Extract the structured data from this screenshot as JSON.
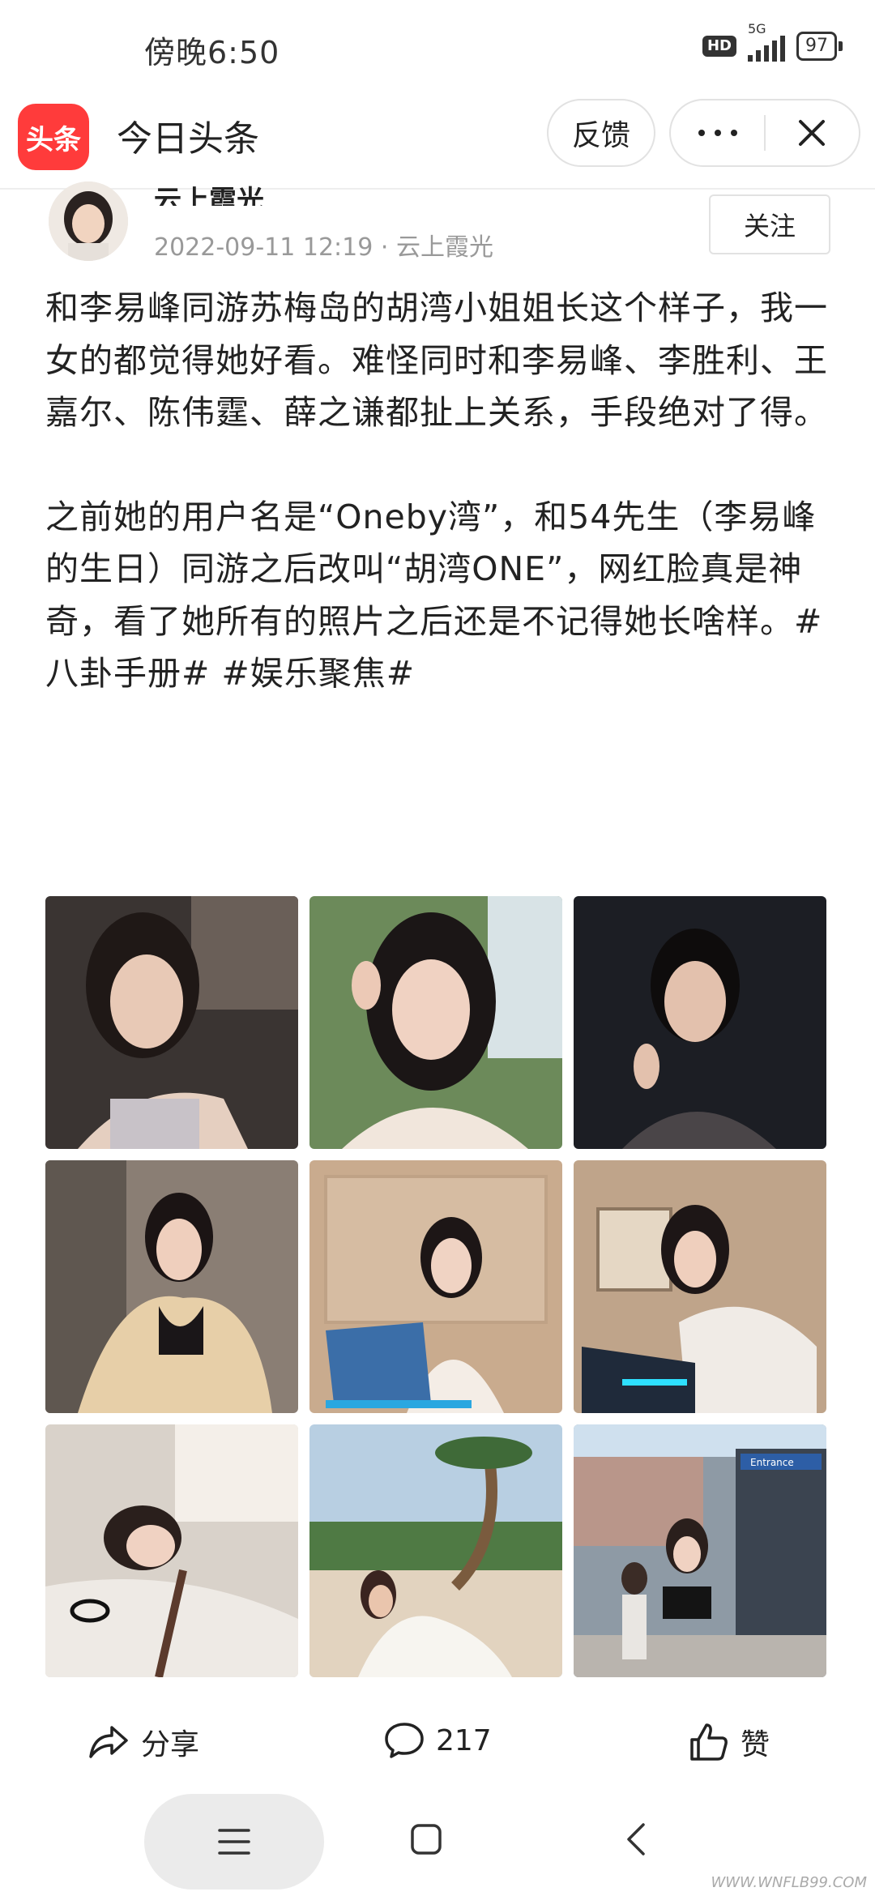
{
  "status_bar": {
    "time": "傍晚6:50",
    "hd": "HD",
    "network": "5G",
    "battery": "97"
  },
  "header": {
    "logo_text": "头条",
    "title": "今日头条",
    "feedback_label": "反馈"
  },
  "author": {
    "name": "云上霞光",
    "date": "2022-09-11 12:19",
    "separator": "·",
    "source": "云上霞光",
    "follow_label": "关注"
  },
  "article": {
    "paragraph1": "和李易峰同游苏梅岛的胡湾小姐姐长这个样子，我一女的都觉得她好看。难怪同时和李易峰、李胜利、王嘉尔、陈伟霆、薛之谦都扯上关系，手段绝对了得。",
    "paragraph2": "之前她的用户名是“Oneby湾”，和54先生（李易峰的生日）同游之后改叫“胡湾ONE”，网红脸真是神奇，看了她所有的照片之后还是不记得她长啥样。#八卦手册# #娱乐聚焦#"
  },
  "photos": [
    {
      "name": "car-selfie",
      "bg": "#3a3432"
    },
    {
      "name": "garden-selfie",
      "bg": "#6c8a5a"
    },
    {
      "name": "night-selfie",
      "bg": "#1c1e24"
    },
    {
      "name": "mirror-fur-coat",
      "bg": "#8a7e74"
    },
    {
      "name": "laptop-glasses",
      "bg": "#c9ab8e"
    },
    {
      "name": "laptop-desk",
      "bg": "#bfa48a"
    },
    {
      "name": "bed-lying",
      "bg": "#d9d2ca"
    },
    {
      "name": "beach-palm",
      "bg": "#b8cfe2"
    },
    {
      "name": "street-entrance",
      "bg": "#8e9aa5"
    }
  ],
  "actions": {
    "share_label": "分享",
    "comment_count": "217",
    "like_label": "赞"
  },
  "entrance_sign": "Entrance",
  "watermark": "WWW.WNFLB99.COM"
}
